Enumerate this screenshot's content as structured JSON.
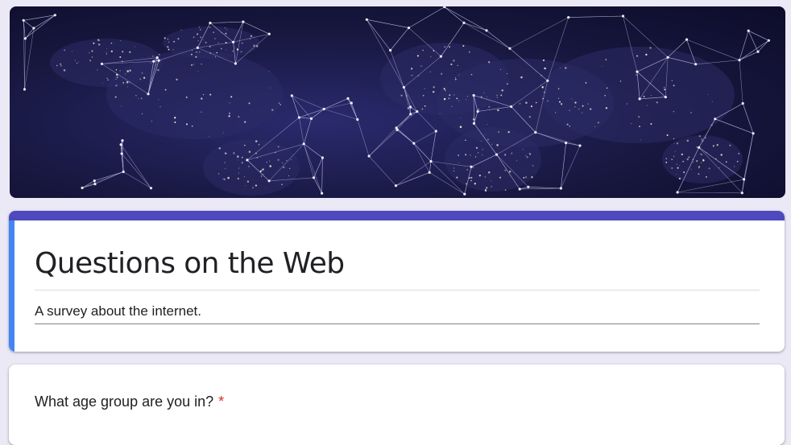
{
  "header": {
    "image": "world-network-map"
  },
  "form": {
    "title": "Questions on the Web",
    "description": "A survey about the internet.",
    "accent_color": "#4e49bf",
    "focus_color": "#4285f4"
  },
  "questions": [
    {
      "text": "What age group are you in?",
      "required_marker": "*"
    }
  ]
}
